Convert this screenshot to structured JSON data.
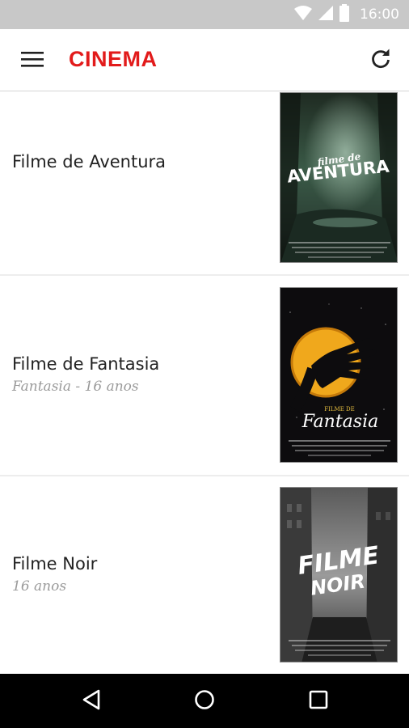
{
  "status_bar": {
    "time": "16:00"
  },
  "app_bar": {
    "title": "CINEMA"
  },
  "movies": [
    {
      "title": "Filme de Aventura",
      "subtitle": "",
      "poster_text_top": "filme de",
      "poster_text_main": "AVENTURA"
    },
    {
      "title": "Filme de Fantasia",
      "subtitle": "Fantasia - 16 anos",
      "poster_text_top": "FILME DE",
      "poster_text_main": "Fantasia"
    },
    {
      "title": "Filme Noir",
      "subtitle": "16 anos",
      "poster_text_top": "FILME",
      "poster_text_main": "NOIR"
    }
  ],
  "colors": {
    "accent": "#e21b1b",
    "status_bar": "#c8c8c8",
    "nav_bar": "#000000"
  },
  "icons": [
    "wifi-icon",
    "signal-icon",
    "battery-icon",
    "menu-icon",
    "refresh-icon",
    "back-icon",
    "home-icon",
    "recents-icon"
  ]
}
